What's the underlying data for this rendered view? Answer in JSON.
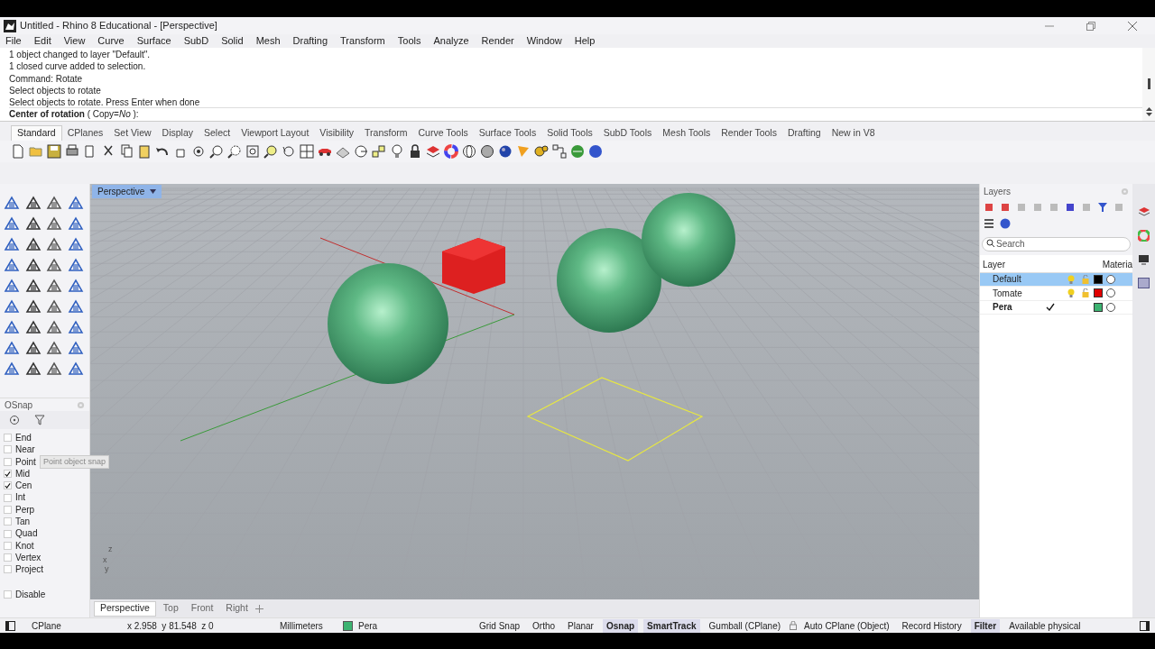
{
  "window": {
    "title": "Untitled - Rhino 8 Educational - [Perspective]"
  },
  "menu": [
    "File",
    "Edit",
    "View",
    "Curve",
    "Surface",
    "SubD",
    "Solid",
    "Mesh",
    "Drafting",
    "Transform",
    "Tools",
    "Analyze",
    "Render",
    "Window",
    "Help"
  ],
  "command_history": [
    "1 object changed to layer \"Default\".",
    "1 closed curve added to selection.",
    "Command: Rotate",
    "Select objects to rotate",
    "Select objects to rotate. Press Enter when done"
  ],
  "command_prompt": "**Center of rotation** ( Copy=*No* ):",
  "toolbar_tabs": [
    {
      "label": "Standard",
      "selected": true
    },
    {
      "label": "CPlanes",
      "selected": false
    },
    {
      "label": "Set View",
      "selected": false
    },
    {
      "label": "Display",
      "selected": false
    },
    {
      "label": "Select",
      "selected": false
    },
    {
      "label": "Viewport Layout",
      "selected": false
    },
    {
      "label": "Visibility",
      "selected": false
    },
    {
      "label": "Transform",
      "selected": false
    },
    {
      "label": "Curve Tools",
      "selected": false
    },
    {
      "label": "Surface Tools",
      "selected": false
    },
    {
      "label": "Solid Tools",
      "selected": false
    },
    {
      "label": "SubD Tools",
      "selected": false
    },
    {
      "label": "Mesh Tools",
      "selected": false
    },
    {
      "label": "Render Tools",
      "selected": false
    },
    {
      "label": "Drafting",
      "selected": false
    },
    {
      "label": "New in V8",
      "selected": false
    }
  ],
  "viewport": {
    "title": "Perspective",
    "axis_labels": [
      "z",
      "x",
      "y"
    ]
  },
  "osnap": {
    "title": "OSnap",
    "items": [
      {
        "label": "End",
        "checked": false
      },
      {
        "label": "Near",
        "checked": false
      },
      {
        "label": "Point",
        "checked": false
      },
      {
        "label": "Mid",
        "checked": true
      },
      {
        "label": "Cen",
        "checked": true
      },
      {
        "label": "Int",
        "checked": false
      },
      {
        "label": "Perp",
        "checked": false
      },
      {
        "label": "Tan",
        "checked": false
      },
      {
        "label": "Quad",
        "checked": false
      },
      {
        "label": "Knot",
        "checked": false
      },
      {
        "label": "Vertex",
        "checked": false
      },
      {
        "label": "Project",
        "checked": false
      }
    ],
    "disable": {
      "label": "Disable",
      "checked": false
    },
    "tooltip": "Point object snap"
  },
  "layers": {
    "title": "Layers",
    "search_placeholder": "Search",
    "columns": [
      "Layer",
      "Materia"
    ],
    "rows": [
      {
        "name": "Default",
        "selected": true,
        "current": false,
        "color": "#000000"
      },
      {
        "name": "Tomate",
        "selected": false,
        "current": false,
        "color": "#e00000"
      },
      {
        "name": "Pera",
        "selected": false,
        "current": true,
        "color": "#3cb371"
      }
    ]
  },
  "viewport_tabs": [
    {
      "label": "Perspective",
      "selected": true
    },
    {
      "label": "Top",
      "selected": false
    },
    {
      "label": "Front",
      "selected": false
    },
    {
      "label": "Right",
      "selected": false
    }
  ],
  "status_bar": {
    "cplane": "CPlane",
    "coordinates": "x 2.958  y 81.548  z 0",
    "units": "Millimeters",
    "layer": {
      "name": "Pera",
      "color": "#3cb371"
    },
    "toggles": [
      {
        "label": "Grid Snap",
        "on": false
      },
      {
        "label": "Ortho",
        "on": false
      },
      {
        "label": "Planar",
        "on": false
      },
      {
        "label": "Osnap",
        "on": true
      },
      {
        "label": "SmartTrack",
        "on": true
      },
      {
        "label": "Gumball (CPlane)",
        "on": false
      },
      {
        "label": "Auto CPlane (Object)",
        "on": false
      },
      {
        "label": "Record History",
        "on": false
      },
      {
        "label": "Filter",
        "on": true
      },
      {
        "label": "Available physical",
        "on": false
      }
    ]
  }
}
